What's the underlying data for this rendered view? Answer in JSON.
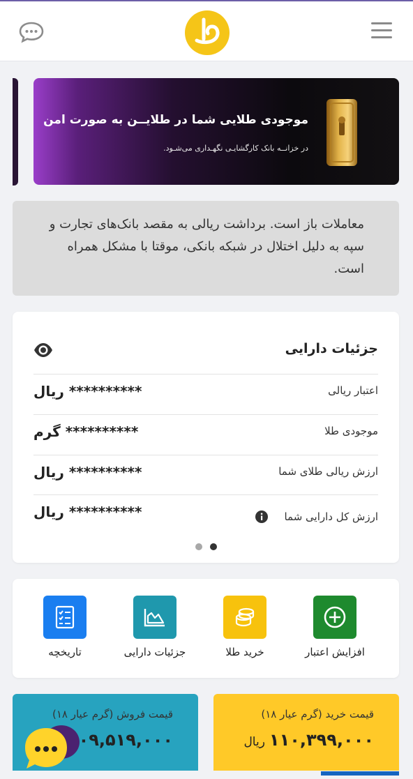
{
  "header": {
    "chat_icon": "chat-bubble-icon",
    "logo_icon": "gold-logo-icon",
    "menu_icon": "hamburger-menu-icon"
  },
  "banner": {
    "title": "موجودی طلایی شما در طلایــن به صورت امن",
    "subtitle": "در خزانــه بانک کارگشایـی نگهـداری می‌شـود."
  },
  "notice": {
    "text": "معاملات باز است. برداشت ریالی به مقصد بانک‌های تجارت و سپه به دلیل اختلال در شبکه بانکی، موقتا با مشکل همراه است."
  },
  "assets": {
    "title": "جزئیات دارایی",
    "rows": [
      {
        "label": "اعتبار ریالی",
        "value": "********** ریال"
      },
      {
        "label": "موجودی طلا",
        "value": "********** گرم"
      },
      {
        "label": "ارزش ریالی طلای شما",
        "value": "********** ریال"
      },
      {
        "label": "ارزش کل دارایی شما",
        "value": "********** ریال"
      }
    ],
    "carousel_active_index": 1
  },
  "actions": [
    {
      "label": "افزایش اعتبار",
      "color": "#1e8a2e",
      "icon": "plus-circle-icon"
    },
    {
      "label": "خرید طلا",
      "color": "#f7c20d",
      "icon": "coins-icon"
    },
    {
      "label": "جزئیات دارایی",
      "color": "#1f98ad",
      "icon": "chart-icon"
    },
    {
      "label": "تاریخچه",
      "color": "#1a7ef0",
      "icon": "list-icon"
    }
  ],
  "prices": {
    "buy": {
      "title": "قیمت خرید (گرم عیار ۱۸)",
      "value": "۱۱۰,۳۹۹,۰۰۰",
      "unit": "ریال"
    },
    "sell": {
      "title": "قیمت فروش (گرم عیار ۱۸)",
      "value": "۱۰۹,۵۱۹,۰۰۰"
    }
  },
  "colors": {
    "sell_card": "#27a3bf",
    "buy_card": "#ffc928",
    "logo": "#f5c518"
  }
}
